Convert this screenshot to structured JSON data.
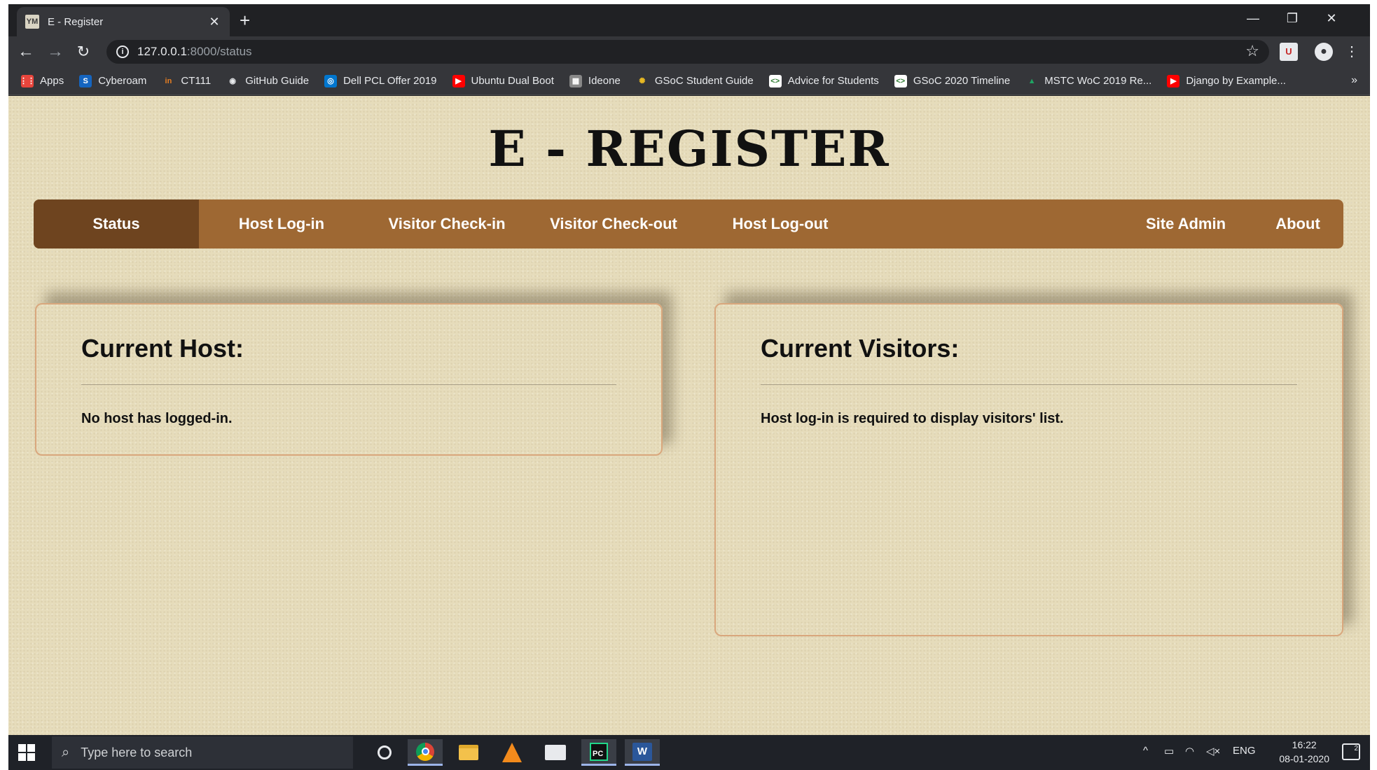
{
  "browser": {
    "tab_title": "E - Register",
    "tab_favicon": "YM",
    "url_host": "127.0.0.1",
    "url_rest": ":8000/status",
    "bookmarks": [
      {
        "label": "Apps",
        "icon": "apps-grid-icon",
        "color": "#e8453c"
      },
      {
        "label": "Cyberoam",
        "icon": "cyberoam-icon",
        "color": "#1565c0"
      },
      {
        "label": "CT111",
        "icon": "ct111-icon",
        "color": "#e67e22"
      },
      {
        "label": "GitHub Guide",
        "icon": "github-icon",
        "color": "#24292e"
      },
      {
        "label": "Dell PCL Offer 2019",
        "icon": "dell-icon",
        "color": "#0076ce"
      },
      {
        "label": "Ubuntu Dual Boot",
        "icon": "youtube-icon",
        "color": "#ff0000"
      },
      {
        "label": "Ideone",
        "icon": "ideone-icon",
        "color": "#888888"
      },
      {
        "label": "GSoC Student Guide",
        "icon": "gsoc-icon",
        "color": "#e8b923"
      },
      {
        "label": "Advice for Students",
        "icon": "code-icon",
        "color": "#ffffff"
      },
      {
        "label": "GSoC 2020 Timeline",
        "icon": "code-icon",
        "color": "#ffffff"
      },
      {
        "label": "MSTC WoC 2019 Re...",
        "icon": "google-drive-icon",
        "color": "#1fa463"
      },
      {
        "label": "Django by Example...",
        "icon": "youtube-icon",
        "color": "#ff0000"
      }
    ],
    "bookmarks_more": "»"
  },
  "site": {
    "title": "E - REGISTER",
    "nav": [
      {
        "label": "Status",
        "active": true
      },
      {
        "label": "Host Log-in"
      },
      {
        "label": "Visitor Check-in"
      },
      {
        "label": "Visitor Check-out"
      },
      {
        "label": "Host Log-out"
      },
      {
        "label": "Site Admin"
      },
      {
        "label": "About"
      }
    ],
    "host_card": {
      "title": "Current Host:",
      "message": "No host has logged-in."
    },
    "visitors_card": {
      "title": "Current Visitors:",
      "message": "Host log-in is required to display visitors' list."
    }
  },
  "taskbar": {
    "search_placeholder": "Type here to search",
    "language": "ENG",
    "time": "16:22",
    "date": "08-01-2020",
    "notification_count": "2"
  },
  "colors": {
    "nav_bg": "#9e6833",
    "nav_active": "#6e441f",
    "page_bg": "#e6dcbb",
    "card_border": "#d9a77d"
  }
}
